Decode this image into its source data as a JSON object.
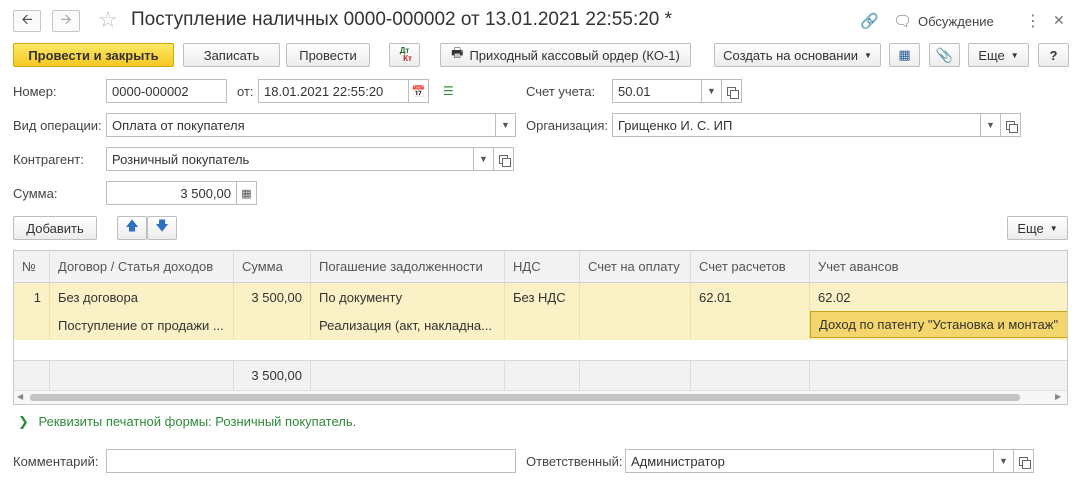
{
  "header": {
    "title": "Поступление наличных 0000-000002 от 13.01.2021 22:55:20 *",
    "discussion": "Обсуждение"
  },
  "toolbar": {
    "post_close": "Провести и закрыть",
    "save": "Записать",
    "post": "Провести",
    "dtkt_top": "Дт",
    "dtkt_bottom": "Кт",
    "print_order": "Приходный кассовый ордер (КО-1)",
    "create_based": "Создать на основании",
    "more": "Еще",
    "help": "?"
  },
  "form": {
    "number_label": "Номер:",
    "number_value": "0000-000002",
    "date_label": "от:",
    "date_value": "18.01.2021 22:55:20",
    "account_label": "Счет учета:",
    "account_value": "50.01",
    "operation_label": "Вид операции:",
    "operation_value": "Оплата от покупателя",
    "org_label": "Организация:",
    "org_value": "Грищенко И. С. ИП",
    "counterparty_label": "Контрагент:",
    "counterparty_value": "Розничный покупатель",
    "sum_label": "Сумма:",
    "sum_value": "3 500,00"
  },
  "table_toolbar": {
    "add": "Добавить",
    "more": "Еще"
  },
  "table": {
    "columns": [
      "№",
      "Договор / Статья доходов",
      "Сумма",
      "Погашение задолженности",
      "НДС",
      "Счет на оплату",
      "Счет расчетов",
      "Учет авансов"
    ],
    "row1": {
      "num": "1",
      "contract": "Без договора",
      "sum": "3 500,00",
      "repayment": "По документу",
      "vat": "Без НДС",
      "invoice": "",
      "settlement": "62.01",
      "advance": "62.02"
    },
    "row2": {
      "contract": "Поступление от продажи ...",
      "repayment": "Реализация (акт, накладна...",
      "advance": "Доход по патенту \"Установка и монтаж\""
    },
    "footer_sum": "3 500,00"
  },
  "print_details": "Реквизиты печатной формы: Розничный покупатель.",
  "footer": {
    "comment_label": "Комментарий:",
    "comment_value": "",
    "responsible_label": "Ответственный:",
    "responsible_value": "Администратор"
  }
}
